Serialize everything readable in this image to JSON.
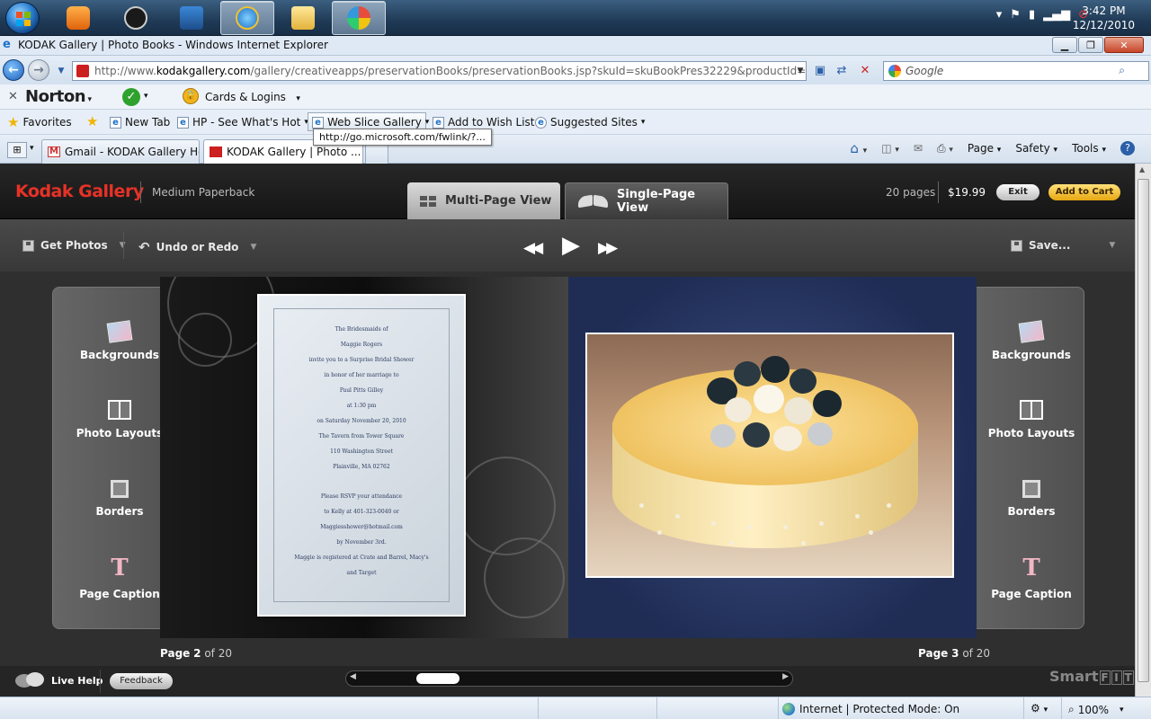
{
  "os": {
    "clock_time": "3:42 PM",
    "clock_date": "12/12/2010"
  },
  "browser": {
    "window_title": "KODAK Gallery | Photo Books - Windows Internet Explorer",
    "url_prefix": "http://www.",
    "url_domain": "kodakgallery.com",
    "url_rest": "/gallery/creativeapps/preservationBooks/preservationBooks.jsp?skuId=skuBookPres32229&productId=proBookPres3",
    "search_placeholder": "Google",
    "norton_label": "Norton",
    "cards_label": "Cards & Logins",
    "favorites": {
      "favorites_label": "Favorites",
      "new_tab": "New Tab",
      "hp": "HP - See What's Hot",
      "web_slice": "Web Slice Gallery",
      "wish_list": "Add to Wish List",
      "suggested": "Suggested Sites"
    },
    "tooltip": "http://go.microsoft.com/fwlink/?...",
    "tabs": [
      {
        "label": "Gmail - KODAK Gallery Ho..."
      },
      {
        "label": "KODAK Gallery | Photo ..."
      }
    ],
    "command_bar": {
      "page": "Page",
      "safety": "Safety",
      "tools": "Tools"
    },
    "status": {
      "zone": "Internet | Protected Mode: On",
      "zoom": "100%"
    }
  },
  "app": {
    "brand": "Kodak Gallery",
    "product": "Medium Paperback",
    "view_tabs": {
      "multi": "Multi-Page View",
      "single": "Single-Page View"
    },
    "pages_count": "20 pages",
    "price": "$19.99",
    "exit_label": "Exit",
    "cart_label": "Add to Cart",
    "toolbar": {
      "get_photos": "Get Photos",
      "undo_redo": "Undo or Redo",
      "save": "Save..."
    },
    "side_tools": {
      "backgrounds": "Backgrounds",
      "photo_layouts": "Photo Layouts",
      "borders": "Borders",
      "page_caption": "Page Caption"
    },
    "invitation_lines": [
      "The Bridesmaids of",
      "Maggie Rogers",
      "invite you to a Surprise Bridal Shower",
      "in honor of her marriage to",
      "Paul Pitts Gilley",
      "at 1:30 pm",
      "on Saturday November 20, 2010",
      "The Tavern from Tower Square",
      "110 Washington Street",
      "Plainville, MA 02762",
      "",
      "Please RSVP your attendance",
      "to Kelly at 401-323-0040 or",
      "Maggiesshower@hotmail.com",
      "by November 3rd.",
      "Maggie is registered at Crate and Barrel, Macy's",
      "and Target"
    ],
    "left_page": {
      "prefix": "Page",
      "number": "2",
      "suffix": "of 20"
    },
    "right_page": {
      "prefix": "Page",
      "number": "3",
      "suffix": "of 20"
    },
    "live_help": "Live Help",
    "feedback": "Feedback",
    "smartfit_word": "Smart",
    "smartfit_boxes": [
      "F",
      "I",
      "T"
    ]
  }
}
